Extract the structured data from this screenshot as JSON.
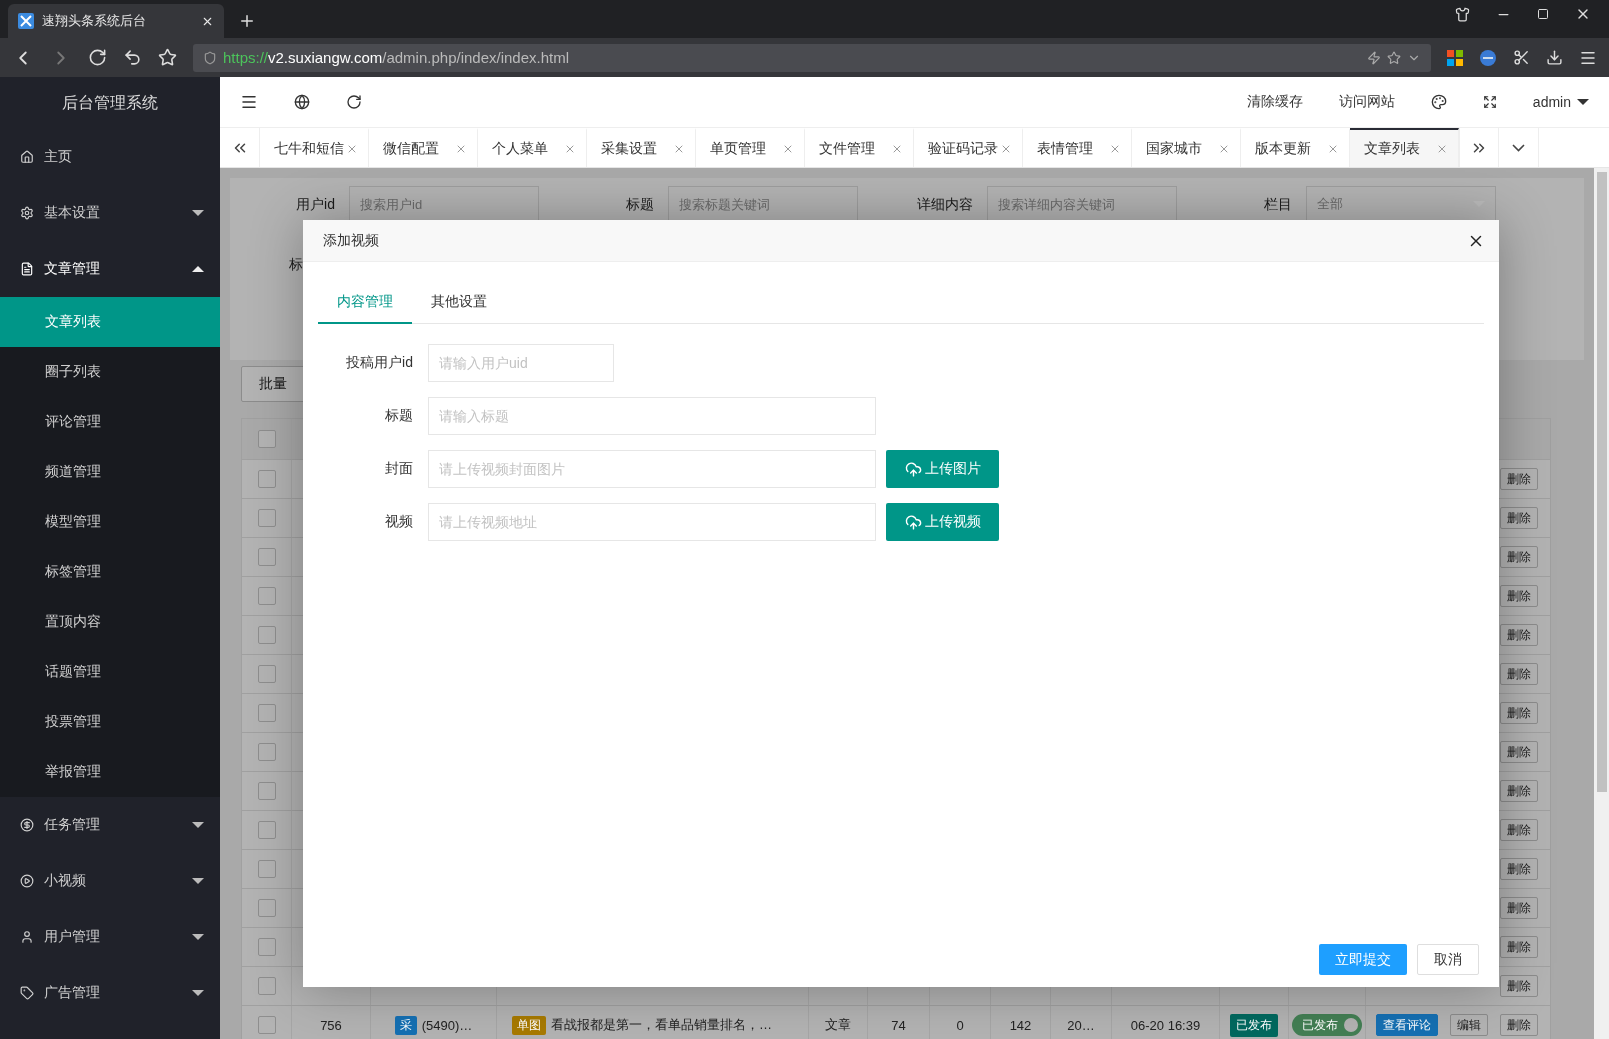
{
  "browser": {
    "tab_title": "速翔头条系统后台",
    "url_scheme": "https://",
    "url_host": "v2.suxiangw.com",
    "url_path": "/admin.php/index/index.html"
  },
  "sidebar": {
    "title": "后台管理系统",
    "items": [
      {
        "label": "主页",
        "kind": "link",
        "expanded": false
      },
      {
        "label": "基本设置",
        "kind": "group",
        "expanded": false
      },
      {
        "label": "文章管理",
        "kind": "group",
        "expanded": true,
        "children": [
          {
            "label": "文章列表",
            "selected": true
          },
          {
            "label": "圈子列表",
            "selected": false
          },
          {
            "label": "评论管理",
            "selected": false
          },
          {
            "label": "频道管理",
            "selected": false
          },
          {
            "label": "模型管理",
            "selected": false
          },
          {
            "label": "标签管理",
            "selected": false
          },
          {
            "label": "置顶内容",
            "selected": false
          },
          {
            "label": "话题管理",
            "selected": false
          },
          {
            "label": "投票管理",
            "selected": false
          },
          {
            "label": "举报管理",
            "selected": false
          }
        ]
      },
      {
        "label": "任务管理",
        "kind": "group",
        "expanded": false
      },
      {
        "label": "小视频",
        "kind": "group",
        "expanded": false
      },
      {
        "label": "用户管理",
        "kind": "group",
        "expanded": false
      },
      {
        "label": "广告管理",
        "kind": "group",
        "expanded": false
      }
    ]
  },
  "header": {
    "links": [
      "清除缓存",
      "访问网站"
    ],
    "user": "admin"
  },
  "tabs": [
    {
      "label": "七牛和短信",
      "selected": false
    },
    {
      "label": "微信配置",
      "selected": false
    },
    {
      "label": "个人菜单",
      "selected": false
    },
    {
      "label": "采集设置",
      "selected": false
    },
    {
      "label": "单页管理",
      "selected": false
    },
    {
      "label": "文件管理",
      "selected": false
    },
    {
      "label": "验证码记录",
      "selected": false
    },
    {
      "label": "表情管理",
      "selected": false
    },
    {
      "label": "国家城市",
      "selected": false
    },
    {
      "label": "版本更新",
      "selected": false
    },
    {
      "label": "文章列表",
      "selected": true
    }
  ],
  "filters": [
    {
      "label": "用户id",
      "placeholder": "搜索用户id",
      "kind": "input"
    },
    {
      "label": "标题",
      "placeholder": "搜索标题关键词",
      "kind": "input"
    },
    {
      "label": "详细内容",
      "placeholder": "搜索详细内容关键词",
      "kind": "input"
    },
    {
      "label": "栏目",
      "placeholder": "全部",
      "kind": "select"
    }
  ],
  "filter_row2_label": "标",
  "batch_button": "批量",
  "table": {
    "header_checked": false,
    "rows": [
      {
        "checked": false,
        "delete": "删除"
      },
      {
        "checked": false,
        "delete": "删除"
      },
      {
        "checked": false,
        "delete": "删除"
      },
      {
        "checked": false,
        "delete": "删除"
      },
      {
        "checked": false,
        "delete": "删除"
      },
      {
        "checked": false,
        "delete": "删除"
      },
      {
        "checked": false,
        "delete": "删除"
      },
      {
        "checked": false,
        "delete": "删除"
      },
      {
        "checked": false,
        "delete": "删除"
      },
      {
        "checked": false,
        "delete": "删除"
      },
      {
        "checked": false,
        "delete": "删除"
      },
      {
        "checked": false,
        "delete": "删除"
      },
      {
        "checked": false,
        "delete": "删除"
      },
      {
        "checked": false,
        "delete": "删除"
      },
      {
        "checked": false,
        "id": "756",
        "source_tag": "采",
        "source": "(5490)…",
        "title_tag": "单图",
        "title": "看战报都是第一，看单品销量排名，…",
        "type": "文章",
        "column_6": "74",
        "column_7": "0",
        "column_8": "142",
        "column_9": "20…",
        "time": "06-20 16:39",
        "status": "已发布",
        "publish": {
          "label": "已发布",
          "on": true
        },
        "comments": "查看评论",
        "edit": "编辑",
        "delete": "删除"
      }
    ]
  },
  "modal": {
    "title": "添加视频",
    "tabs": [
      {
        "label": "内容管理",
        "selected": true
      },
      {
        "label": "其他设置",
        "selected": false
      }
    ],
    "fields": [
      {
        "label": "投稿用户id",
        "placeholder": "请输入用户uid",
        "kind": "short"
      },
      {
        "label": "标题",
        "placeholder": "请输入标题",
        "kind": "wide"
      },
      {
        "label": "封面",
        "placeholder": "请上传视频封面图片",
        "kind": "upload",
        "button": "上传图片"
      },
      {
        "label": "视频",
        "placeholder": "请上传视频地址",
        "kind": "upload",
        "button": "上传视频"
      }
    ],
    "submit": "立即提交",
    "cancel": "取消"
  }
}
